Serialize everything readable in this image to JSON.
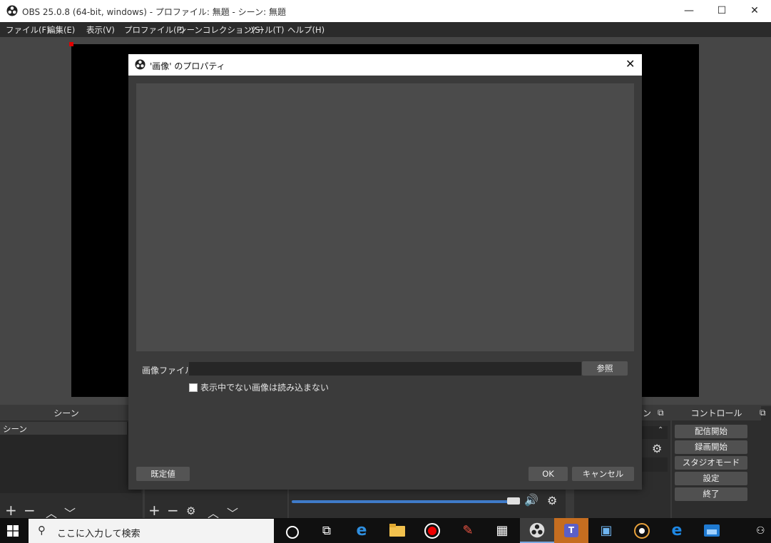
{
  "window": {
    "title": "OBS 25.0.8 (64-bit, windows) - プロファイル: 無題 - シーン: 無題"
  },
  "menu": [
    "ファイル(F)",
    "編集(E)",
    "表示(V)",
    "プロファイル(P)",
    "シーンコレクション(S)",
    "ツール(T)",
    "ヘルプ(H)"
  ],
  "scenes": {
    "header": "シーン",
    "items": [
      "シーン"
    ]
  },
  "mixer": {
    "header_partial": "ン"
  },
  "controls": {
    "header": "コントロール",
    "buttons": [
      "配信開始",
      "録画開始",
      "スタジオモード",
      "設定",
      "終了"
    ]
  },
  "dialog": {
    "title": "'画像' のプロパティ",
    "image_file_label": "画像ファイル",
    "image_file_value": "",
    "browse_label": "参照",
    "checkbox_label": "表示中でない画像は読み込まない",
    "checkbox_checked": false,
    "defaults_label": "既定値",
    "ok_label": "OK",
    "cancel_label": "キャンセル"
  },
  "taskbar": {
    "search_placeholder": "ここに入力して検索"
  },
  "colors": {
    "accent": "#4a90d9",
    "preview": "#000000",
    "handle": "#e00000"
  }
}
